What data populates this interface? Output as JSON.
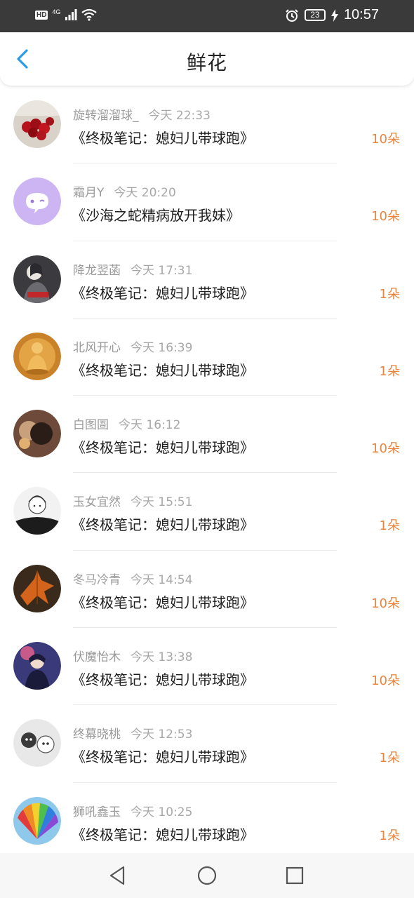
{
  "status_bar": {
    "hd": "HD",
    "network": "4G",
    "battery": "23",
    "time": "10:57"
  },
  "header": {
    "title": "鲜花"
  },
  "items": [
    {
      "name": "旋转溜溜球_",
      "time": "今天 22:33",
      "book": "《终极笔记：媳妇儿带球跑》",
      "count": "10朵",
      "avatar": "roses-photo"
    },
    {
      "name": "霜月Y",
      "time": "今天 20:20",
      "book": "《沙海之蛇精病放开我妹》",
      "count": "10朵",
      "avatar": "default-chat-bubble"
    },
    {
      "name": "降龙翌菡",
      "time": "今天 17:31",
      "book": "《终极笔记：媳妇儿带球跑》",
      "count": "1朵",
      "avatar": "anime-girl"
    },
    {
      "name": "北风开心",
      "time": "今天 16:39",
      "book": "《终极笔记：媳妇儿带球跑》",
      "count": "1朵",
      "avatar": "golden-buddha"
    },
    {
      "name": "白图圄",
      "time": "今天 16:12",
      "book": "《终极笔记：媳妇儿带球跑》",
      "count": "10朵",
      "avatar": "dark-portrait"
    },
    {
      "name": "玉女宜然",
      "time": "今天 15:51",
      "book": "《终极笔记：媳妇儿带球跑》",
      "count": "1朵",
      "avatar": "sketch-character"
    },
    {
      "name": "冬马冷青",
      "time": "今天 14:54",
      "book": "《终极笔记：媳妇儿带球跑》",
      "count": "10朵",
      "avatar": "autumn-leaf"
    },
    {
      "name": "伏魔怡木",
      "time": "今天 13:38",
      "book": "《终极笔记：媳妇儿带球跑》",
      "count": "10朵",
      "avatar": "anime-boy"
    },
    {
      "name": "终幕晓桃",
      "time": "今天 12:53",
      "book": "《终极笔记：媳妇儿带球跑》",
      "count": "1朵",
      "avatar": "cartoon-figures"
    },
    {
      "name": "狮吼鑫玉",
      "time": "今天 10:25",
      "book": "《终极笔记：媳妇儿带球跑》",
      "count": "1朵",
      "avatar": "rainbow-fan"
    }
  ],
  "nav": {
    "back": "back-triangle-icon",
    "home": "home-circle-icon",
    "recent": "recent-square-icon"
  },
  "colors": {
    "accent_blue": "#2b9ce8",
    "count_orange": "#e8843e",
    "status_bar_bg": "#3a3a3a"
  }
}
